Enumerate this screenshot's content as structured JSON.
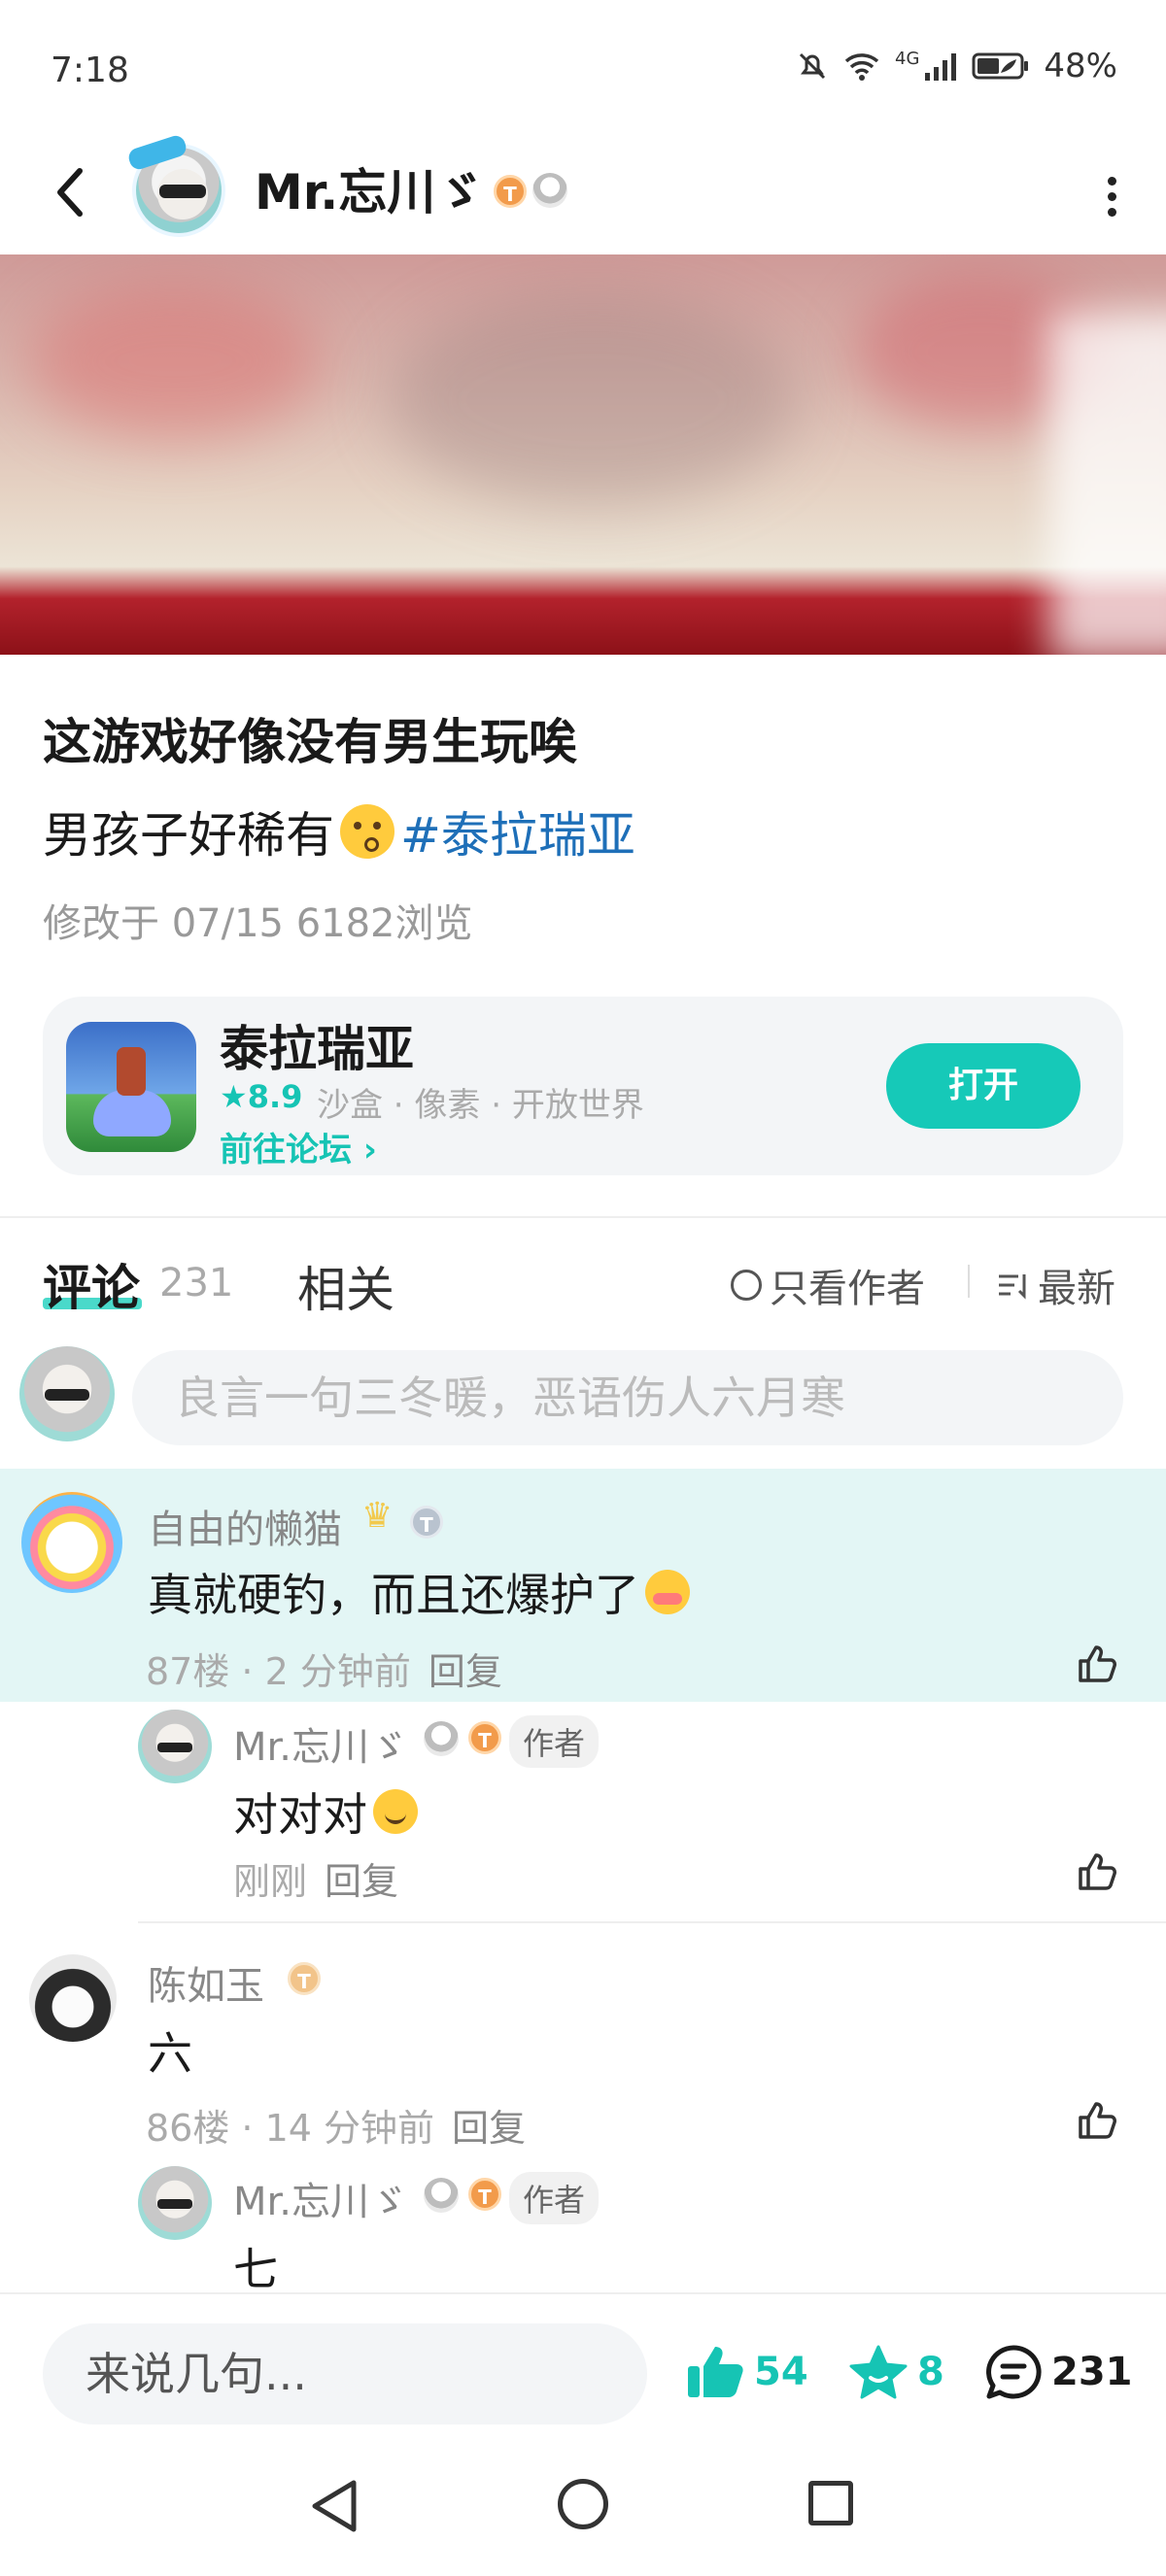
{
  "status_bar": {
    "time": "7:18",
    "network": "4G",
    "battery": "48%"
  },
  "header": {
    "username": "Mr.忘川ゞ",
    "badge_level": "T"
  },
  "post": {
    "title": "这游戏好像没有男生玩唉",
    "body": "男孩子好稀有",
    "hashtag": "#泰拉瑞亚",
    "meta": "修改于 07/15  6182浏览"
  },
  "game_card": {
    "name": "泰拉瑞亚",
    "score": "8.9",
    "tags": "沙盒 · 像素 · 开放世界",
    "forum_link": "前往论坛",
    "open_button": "打开"
  },
  "tabs": {
    "comments_label": "评论",
    "comments_count": "231",
    "related_label": "相关",
    "only_author": "只看作者",
    "sort": "最新"
  },
  "comment_input": {
    "placeholder": "良言一句三冬暖，恶语伤人六月寒"
  },
  "comments": [
    {
      "name": "自由的懒猫",
      "text": "真就硬钓，而且还爆护了",
      "meta": "87楼 · 2 分钟前",
      "reply_label": "回复",
      "reply": {
        "name": "Mr.忘川ゞ",
        "tag": "作者",
        "text": "对对对",
        "meta": "刚刚",
        "reply_label": "回复"
      }
    },
    {
      "name": "陈如玉",
      "text": "六",
      "meta": "86楼 · 14 分钟前",
      "reply_label": "回复",
      "reply": {
        "name": "Mr.忘川ゞ",
        "tag": "作者",
        "text": "七"
      }
    }
  ],
  "bottom_bar": {
    "input_placeholder": "来说几句...",
    "likes": "54",
    "favorites": "8",
    "comments": "231"
  },
  "colors": {
    "accent": "#16c4b4",
    "hashtag": "#1e6fb8",
    "highlight_bg": "#e3f6f5"
  }
}
